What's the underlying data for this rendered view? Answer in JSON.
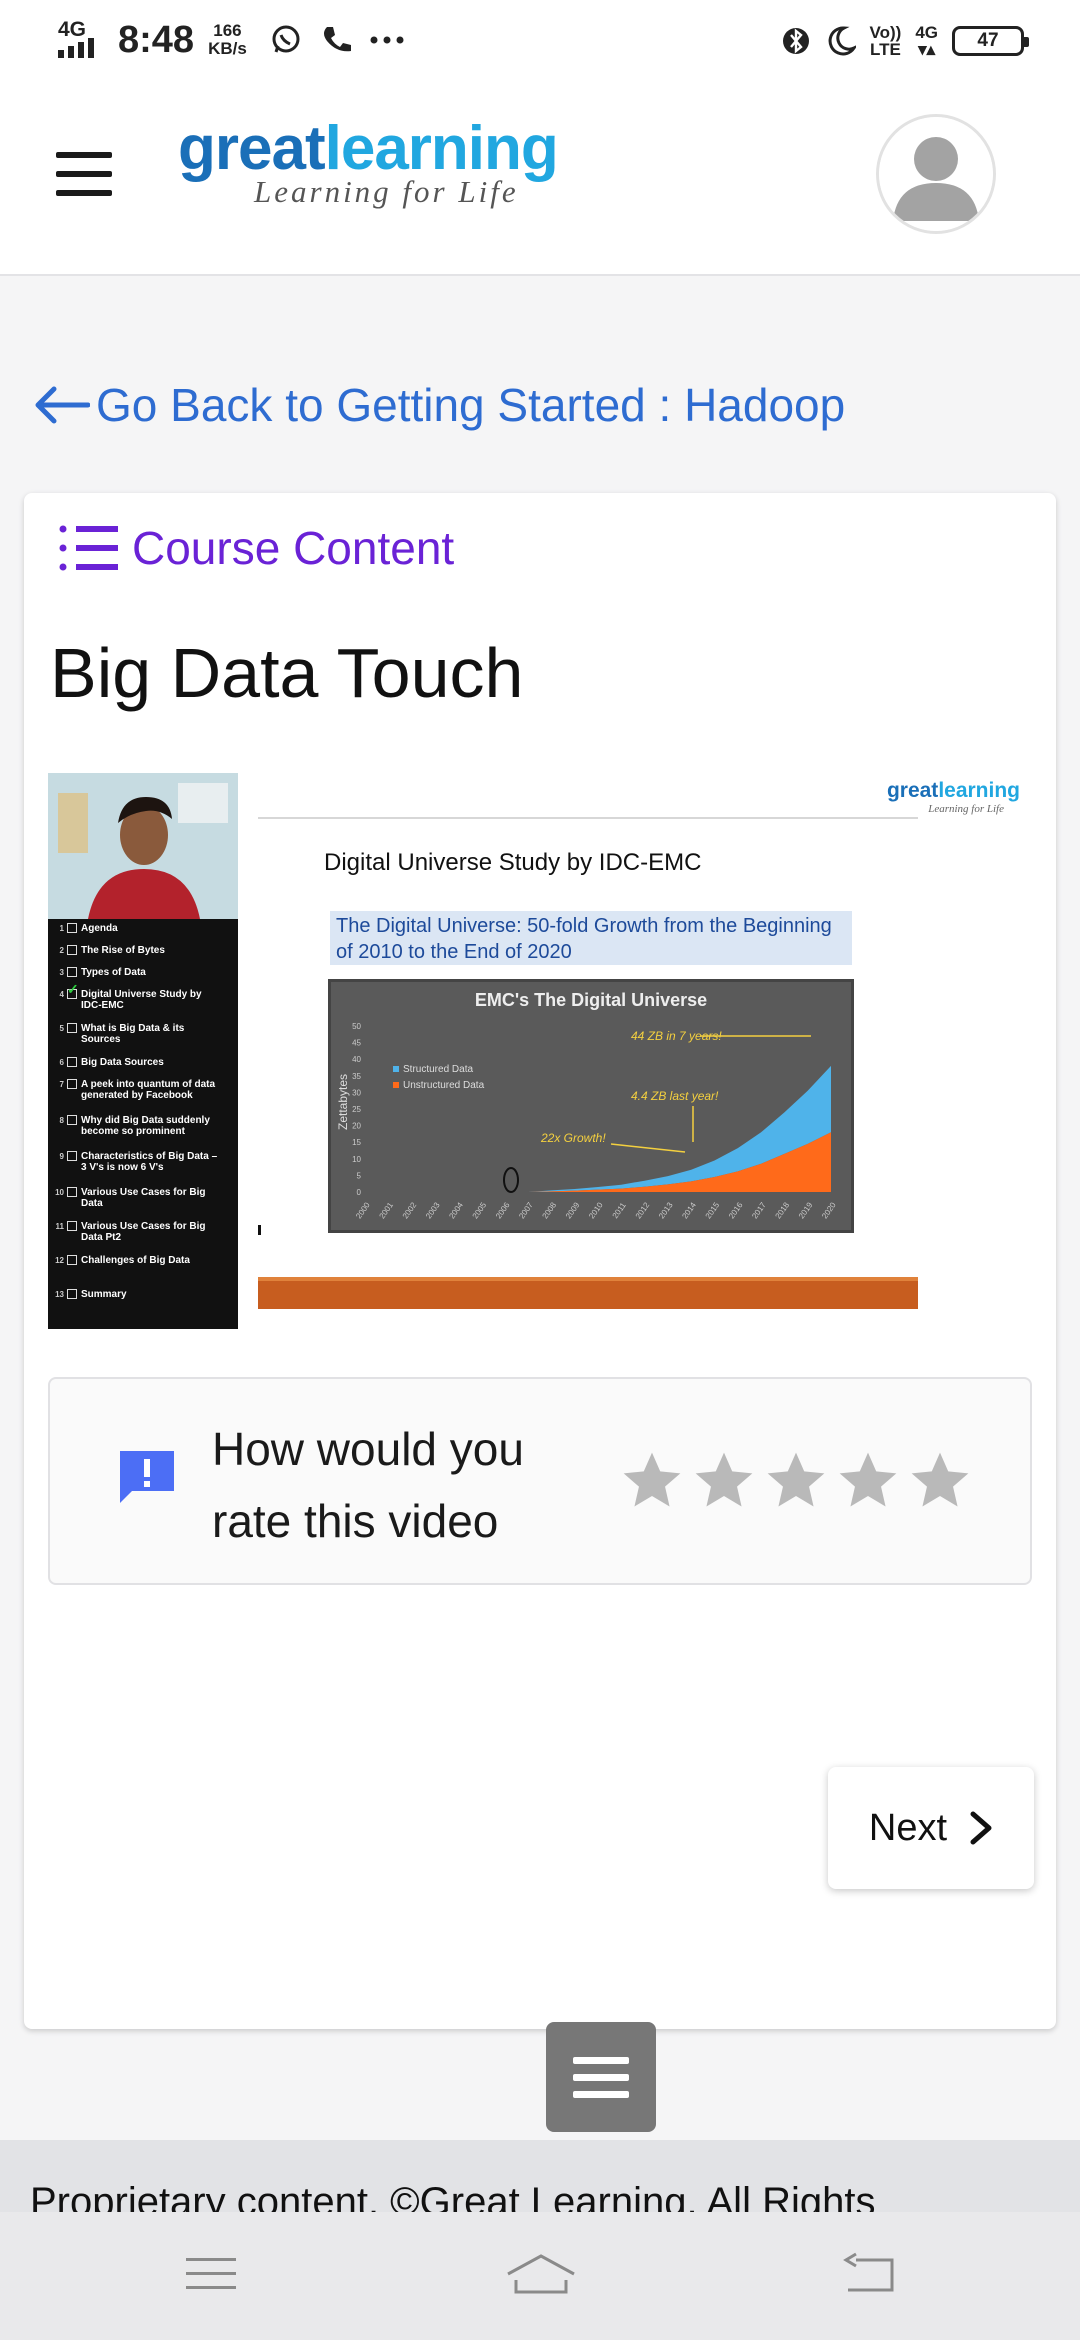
{
  "status_bar": {
    "network": "4G",
    "time": "8:48",
    "speed_value": "166",
    "speed_unit": "KB/s",
    "volte_top": "Vo))",
    "volte_bottom": "LTE",
    "network_right": "4G",
    "battery": "47",
    "icons": [
      "whatsapp-icon",
      "phone-icon",
      "more-dots-icon",
      "bluetooth-icon",
      "moon-icon"
    ]
  },
  "header": {
    "logo_part1": "great",
    "logo_part2": "learning",
    "logo_tagline": "Learning for Life",
    "brand_colors": {
      "dark_blue": "#1a6fb8",
      "light_blue": "#21a7e0"
    }
  },
  "nav": {
    "back_link": "Go Back to Getting Started : Hadoop",
    "link_color": "#2e6cd1"
  },
  "content": {
    "course_content_label": "Course Content",
    "course_content_color": "#6a22d6",
    "lesson_title": "Big Data Touch"
  },
  "video": {
    "agenda": [
      {
        "num": "1",
        "text": "Agenda",
        "checked": false
      },
      {
        "num": "2",
        "text": "The Rise of Bytes",
        "checked": false
      },
      {
        "num": "3",
        "text": "Types of Data",
        "checked": false
      },
      {
        "num": "4",
        "text": "Digital Universe Study by IDC-EMC",
        "checked": true
      },
      {
        "num": "5",
        "text": "What is Big Data & its Sources",
        "checked": false
      },
      {
        "num": "6",
        "text": "Big Data Sources",
        "checked": false
      },
      {
        "num": "7",
        "text": "A peek into quantum of data generated by Facebook",
        "checked": false
      },
      {
        "num": "8",
        "text": "Why did Big Data suddenly become so prominent",
        "checked": false
      },
      {
        "num": "9",
        "text": "Characteristics of Big Data – 3 V's is now 6 V's",
        "checked": false
      },
      {
        "num": "10",
        "text": "Various Use Cases for Big Data",
        "checked": false
      },
      {
        "num": "11",
        "text": "Various Use Cases for Big Data Pt2",
        "checked": false
      },
      {
        "num": "12",
        "text": "Challenges of Big Data",
        "checked": false
      },
      {
        "num": "13",
        "text": "Summary",
        "checked": false
      }
    ],
    "slide": {
      "logo_part1": "great",
      "logo_part2": "learning",
      "logo_tagline": "Learning for Life",
      "title": "Digital Universe Study by IDC-EMC",
      "subtitle": "The Digital Universe: 50-fold Growth from the Beginning of 2010 to the End of 2020"
    }
  },
  "chart_data": {
    "type": "area",
    "title": "EMC's The Digital Universe",
    "ylabel": "Zettabytes",
    "xlabel": "",
    "ylim": [
      0,
      50
    ],
    "yticks": [
      0,
      5,
      10,
      15,
      20,
      25,
      30,
      35,
      40,
      45,
      50
    ],
    "x": [
      "2000",
      "2001",
      "2002",
      "2003",
      "2004",
      "2005",
      "2006",
      "2007",
      "2008",
      "2009",
      "2010",
      "2011",
      "2012",
      "2013",
      "2014",
      "2015",
      "2016",
      "2017",
      "2018",
      "2019",
      "2020"
    ],
    "series": [
      {
        "name": "Structured Data",
        "color": "#4fb3ea",
        "values": [
          0,
          0,
          0,
          0,
          0,
          0,
          0,
          0,
          0.3,
          0.5,
          0.8,
          1.2,
          1.8,
          2.5,
          3.5,
          5,
          7,
          9.5,
          12.5,
          16,
          20
        ]
      },
      {
        "name": "Unstructured Data",
        "color": "#ff6a1a",
        "values": [
          0,
          0,
          0,
          0,
          0,
          0,
          0,
          0,
          0.2,
          0.4,
          0.7,
          1,
          1.6,
          2.3,
          3.2,
          4.5,
          6.2,
          8.5,
          11.5,
          14.5,
          18
        ]
      }
    ],
    "annotations": [
      "44 ZB in 7 years!",
      "4.4 ZB last year!",
      "22x Growth!"
    ],
    "legend_position": "left",
    "background": "#5a5a5a"
  },
  "rating": {
    "question": "How would you rate this video",
    "stars": 5,
    "selected": 0,
    "star_color": "#b9b9b9",
    "icon_color": "#4c6ef5"
  },
  "next_label": "Next",
  "footer_text": "Proprietary content. ©Great Learning. All Rights"
}
